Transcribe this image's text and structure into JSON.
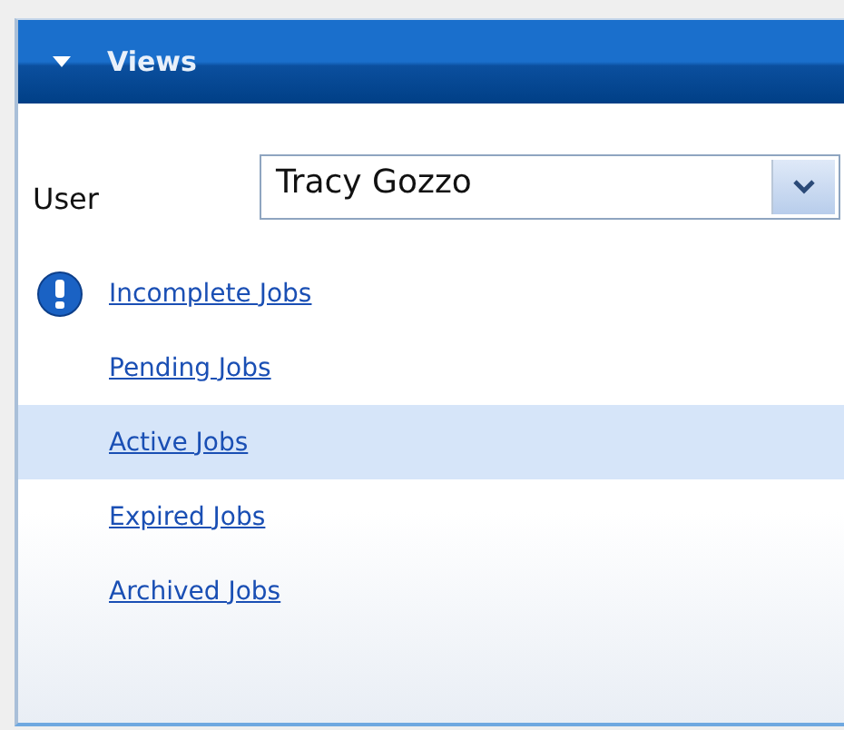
{
  "panel": {
    "title": "Views",
    "expanded": true
  },
  "user_field": {
    "label": "User",
    "value": "Tracy Gozzo"
  },
  "views": [
    {
      "label": "Incomplete Jobs",
      "alert": true,
      "selected": false
    },
    {
      "label": "Pending Jobs",
      "alert": false,
      "selected": false
    },
    {
      "label": "Active Jobs",
      "alert": false,
      "selected": true
    },
    {
      "label": "Expired Jobs",
      "alert": false,
      "selected": false
    },
    {
      "label": "Archived Jobs",
      "alert": false,
      "selected": false
    }
  ]
}
